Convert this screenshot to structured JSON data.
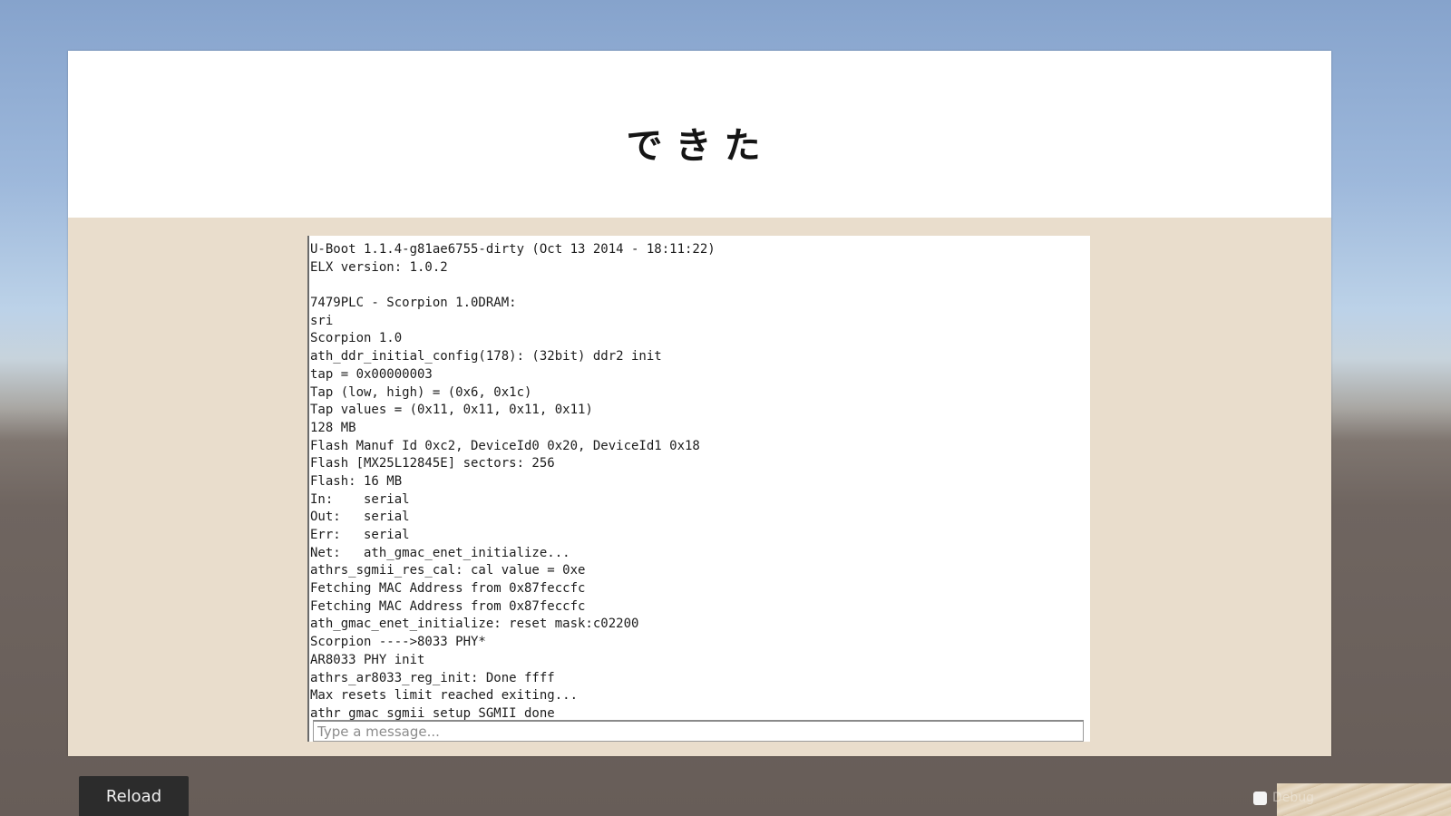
{
  "page": {
    "title": "できた"
  },
  "console": {
    "lines": [
      "U-Boot 1.1.4-g81ae6755-dirty (Oct 13 2014 - 18:11:22)",
      "ELX version: 1.0.2",
      "",
      "7479PLC - Scorpion 1.0DRAM:",
      "sri",
      "Scorpion 1.0",
      "ath_ddr_initial_config(178): (32bit) ddr2 init",
      "tap = 0x00000003",
      "Tap (low, high) = (0x6, 0x1c)",
      "Tap values = (0x11, 0x11, 0x11, 0x11)",
      "128 MB",
      "Flash Manuf Id 0xc2, DeviceId0 0x20, DeviceId1 0x18",
      "Flash [MX25L12845E] sectors: 256",
      "Flash: 16 MB",
      "In:    serial",
      "Out:   serial",
      "Err:   serial",
      "Net:   ath_gmac_enet_initialize...",
      "athrs_sgmii_res_cal: cal value = 0xe",
      "Fetching MAC Address from 0x87feccfc",
      "Fetching MAC Address from 0x87feccfc",
      "ath_gmac_enet_initialize: reset mask:c02200",
      "Scorpion ---->8033 PHY*",
      "AR8033 PHY init",
      "athrs_ar8033_reg_init: Done ffff",
      "Max resets limit reached exiting...",
      "athr_gmac_sgmii_setup SGMII done"
    ]
  },
  "input": {
    "placeholder": "Type a message..."
  },
  "controls": {
    "reload_label": "Reload",
    "debug_label": "Debug"
  }
}
